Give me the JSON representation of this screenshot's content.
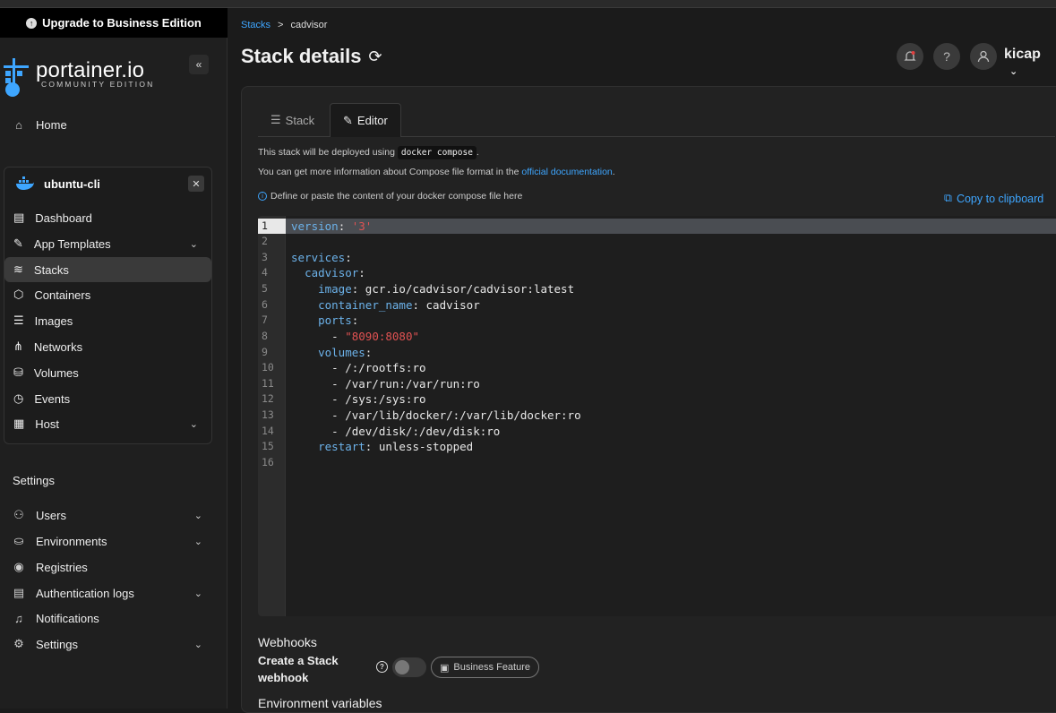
{
  "upgrade": {
    "label": "Upgrade to Business Edition"
  },
  "logo": {
    "name": "portainer.io",
    "edition": "COMMUNITY EDITION"
  },
  "nav": {
    "home": "Home"
  },
  "environment": {
    "name": "ubuntu-cli",
    "items": [
      {
        "label": "Dashboard",
        "icon": "dashboard-icon"
      },
      {
        "label": "App Templates",
        "icon": "edit-icon"
      },
      {
        "label": "Stacks",
        "icon": "layers-icon"
      },
      {
        "label": "Containers",
        "icon": "cube-icon"
      },
      {
        "label": "Images",
        "icon": "list-icon"
      },
      {
        "label": "Networks",
        "icon": "share-icon"
      },
      {
        "label": "Volumes",
        "icon": "database-icon"
      },
      {
        "label": "Events",
        "icon": "clock-icon"
      },
      {
        "label": "Host",
        "icon": "host-icon"
      }
    ]
  },
  "settings": {
    "title": "Settings",
    "items": [
      {
        "label": "Users"
      },
      {
        "label": "Environments"
      },
      {
        "label": "Registries"
      },
      {
        "label": "Authentication logs"
      },
      {
        "label": "Notifications"
      },
      {
        "label": "Settings"
      }
    ]
  },
  "breadcrumb": {
    "parent": "Stacks",
    "separator": ">",
    "current": "cadvisor"
  },
  "page": {
    "title": "Stack details"
  },
  "user": {
    "name": "kicap"
  },
  "tabs": {
    "stack": "Stack",
    "editor": "Editor"
  },
  "info": {
    "line1_prefix": "This stack will be deployed using",
    "line1_code": "docker compose",
    "line1_suffix": ".",
    "line2_prefix": "You can get more information about Compose file format in the",
    "line2_link": "official documentation",
    "line2_suffix": ".",
    "define": "Define or paste the content of your docker compose file here",
    "copy": "Copy to clipboard"
  },
  "editor": {
    "line_numbers": [
      "1",
      "2",
      "3",
      "4",
      "5",
      "6",
      "7",
      "8",
      "9",
      "10",
      "11",
      "12",
      "13",
      "14",
      "15",
      "16"
    ]
  },
  "webhooks": {
    "title": "Webhooks",
    "label": "Create a Stack webhook",
    "badge": "Business Feature"
  },
  "envvars": {
    "title": "Environment variables"
  }
}
